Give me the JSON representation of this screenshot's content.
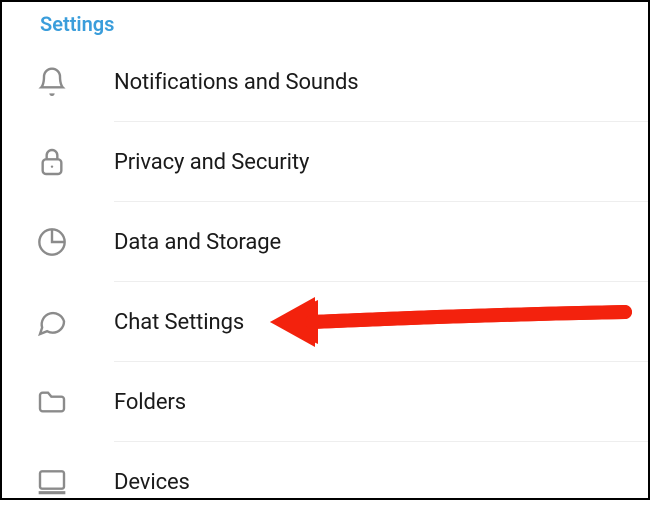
{
  "header": {
    "title": "Settings"
  },
  "items": [
    {
      "icon": "bell-icon",
      "label": "Notifications and Sounds"
    },
    {
      "icon": "lock-icon",
      "label": "Privacy and Security"
    },
    {
      "icon": "pie-icon",
      "label": "Data and Storage"
    },
    {
      "icon": "chat-icon",
      "label": "Chat Settings"
    },
    {
      "icon": "folder-icon",
      "label": "Folders"
    },
    {
      "icon": "devices-icon",
      "label": "Devices"
    }
  ],
  "annotation": {
    "color": "#f3220d",
    "target_index": 3
  }
}
